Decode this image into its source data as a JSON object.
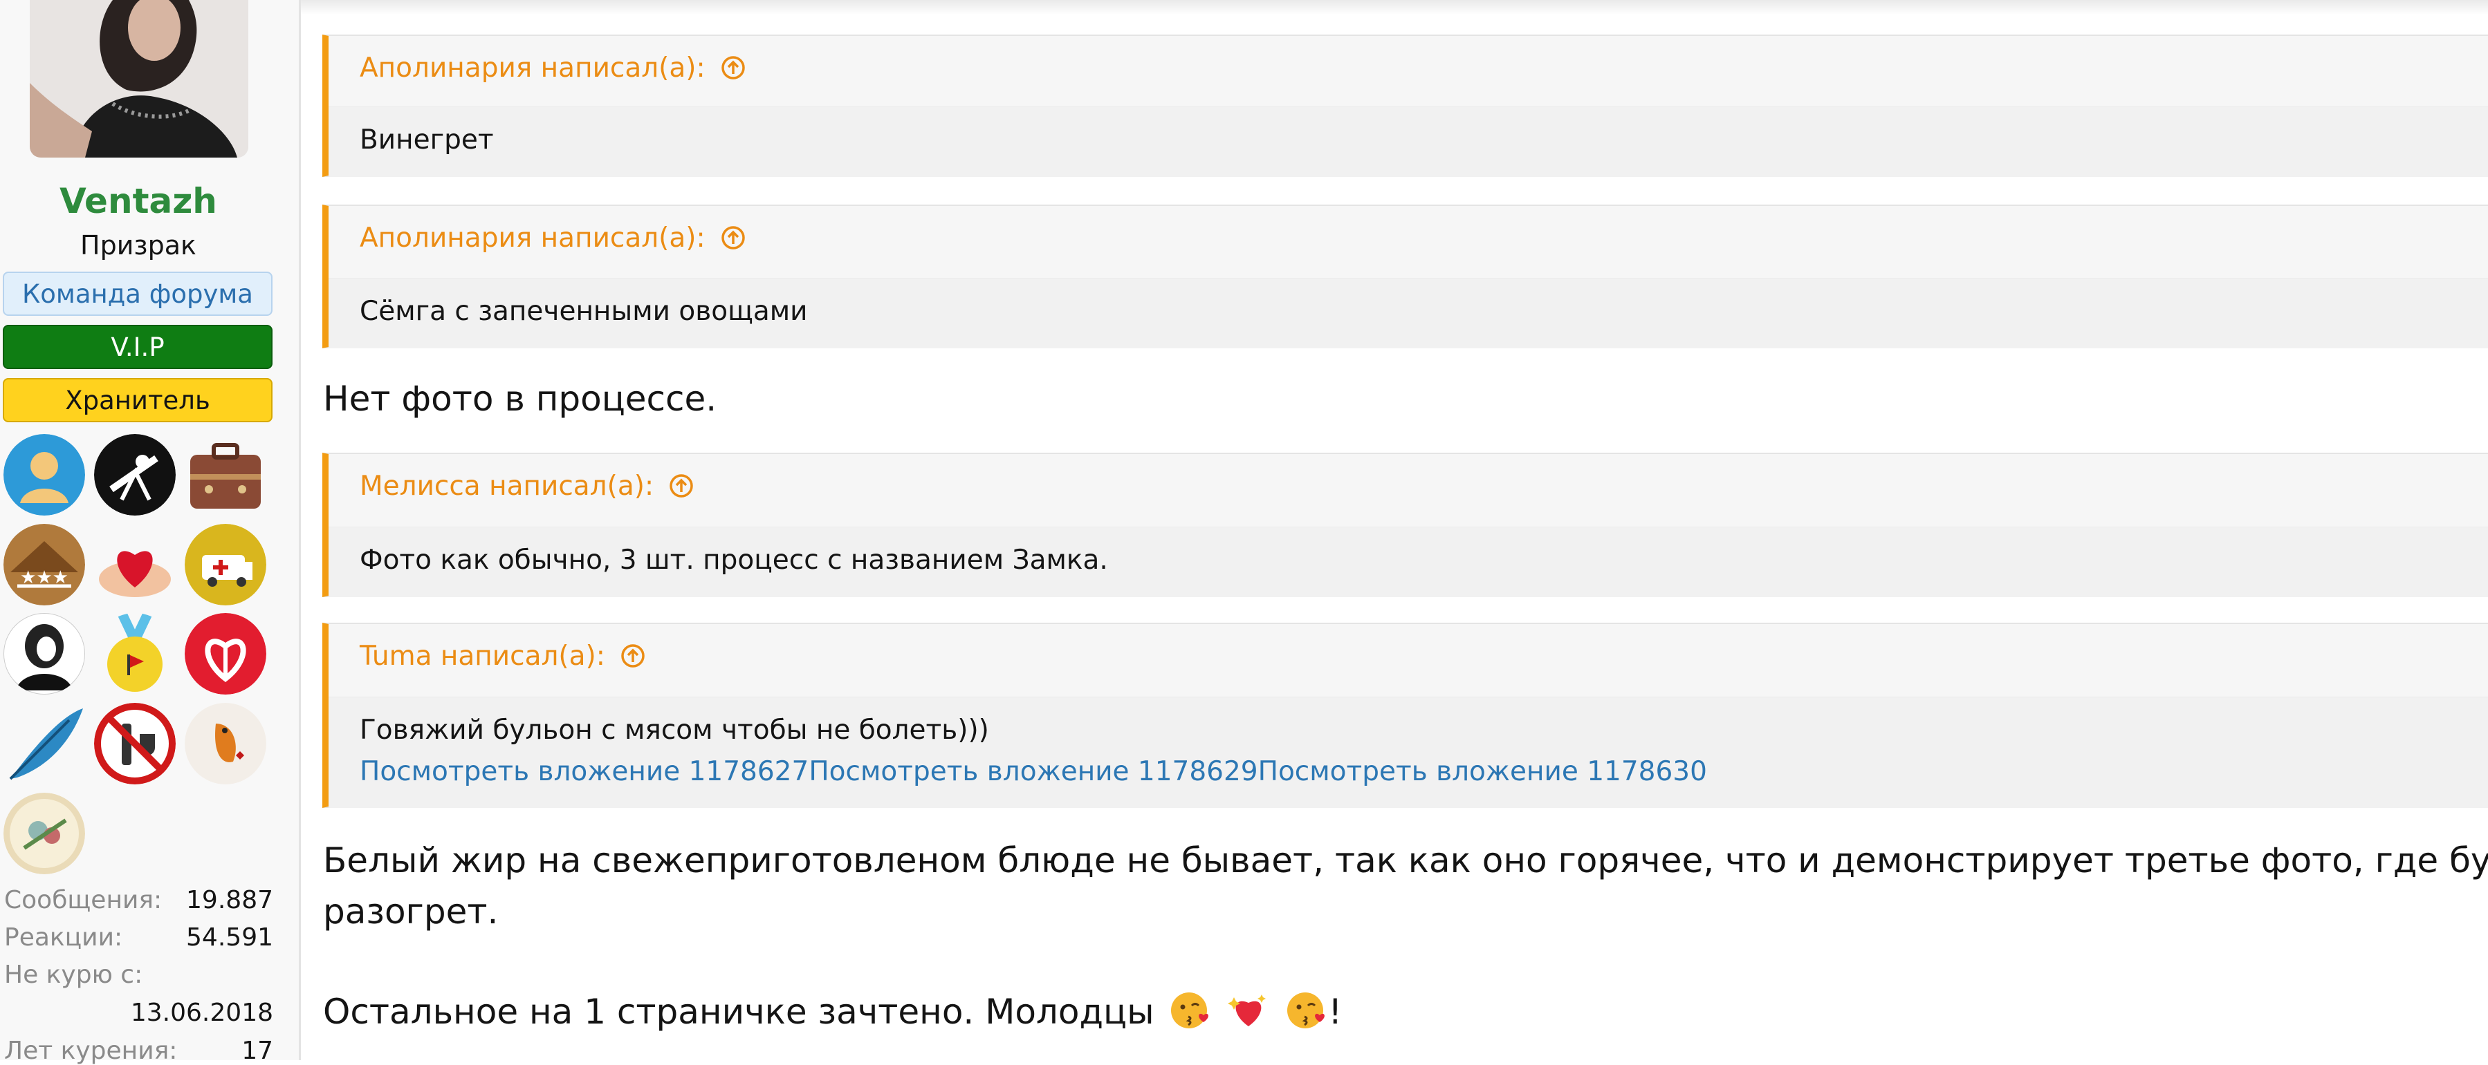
{
  "user": {
    "name": "Ventazh",
    "title": "Призрак",
    "banners": [
      "Команда форума",
      "V.I.P",
      "Хранитель"
    ],
    "stats": [
      {
        "label": "Сообщения:",
        "value": "19.887"
      },
      {
        "label": "Реакции:",
        "value": "54.591"
      },
      {
        "label": "Не курю с:",
        "value": "13.06.2018"
      },
      {
        "label": "Лет курения:",
        "value": "17"
      }
    ]
  },
  "quotes": [
    {
      "author": "Аполинария написал(а):",
      "text": "Винегрет"
    },
    {
      "author": "Аполинария написал(а):",
      "text": "Сёмга с запеченными овощами"
    },
    {
      "author": "Мелисса написал(а):",
      "text": "Фото как обычно, 3 шт. процесс с названием Замка."
    },
    {
      "author": "Tuma написал(а):",
      "text": "Говяжий бульон с мясом чтобы не болеть)))",
      "links": [
        "Посмотреть вложение 1178627",
        "Посмотреть вложение 1178629",
        "Посмотреть вложение 1178630"
      ]
    }
  ],
  "post": {
    "line1": "Нет фото в процессе.",
    "line2a": "Белый жир на свежеприготовленом блюде не бывает, так как оно горячее, что и демонстрирует третье фото, где бульон",
    "line2b": "разогрет.",
    "line3": "Остальное на 1 страничке зачтено. Молодцы",
    "line3_end": "!"
  },
  "colors": {
    "quote_accent": "#f39c12",
    "username": "#2e8b3d",
    "link": "#2c77b4"
  },
  "icons": [
    "arrow-up-circle-icon",
    "kiss-emoji-icon",
    "sparkling-heart-emoji-icon"
  ]
}
